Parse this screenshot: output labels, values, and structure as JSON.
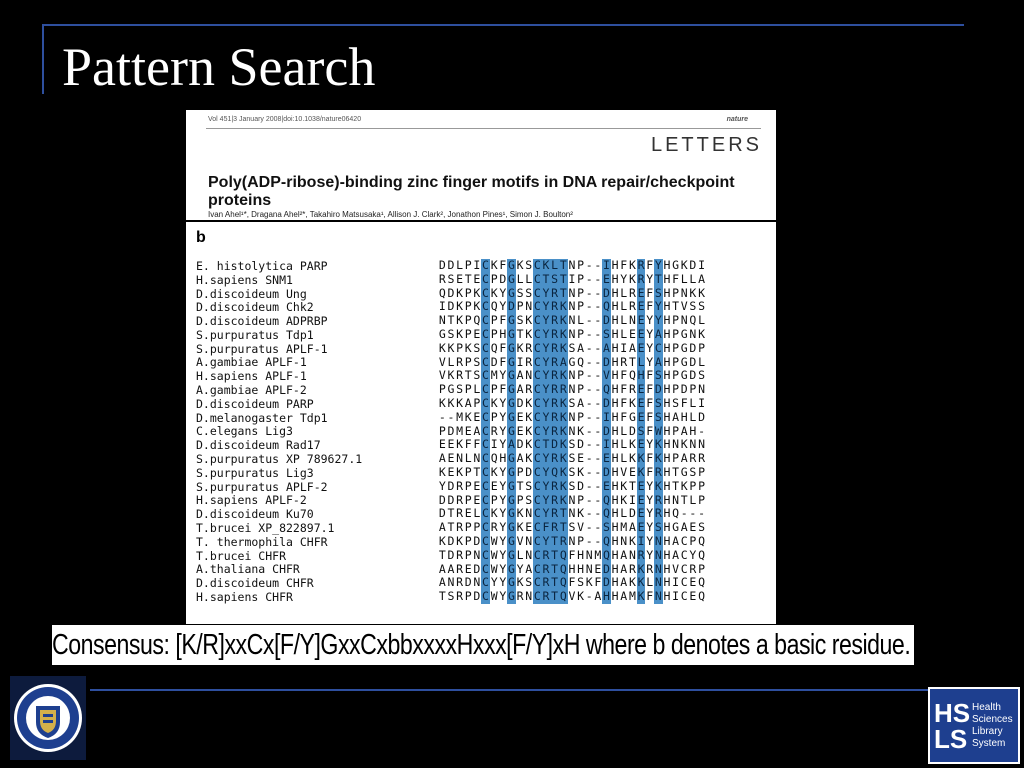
{
  "slide": {
    "title": "Pattern Search",
    "consensus": "Consensus: [K/R]xxCx[F/Y]GxxCxbbxxxxHxxx[F/Y]xH where b denotes a basic residue."
  },
  "paper": {
    "header_line": "Vol 451|3 January 2008|doi:10.1038/nature06420",
    "journal": "nature",
    "section": "LETTERS",
    "title": "Poly(ADP-ribose)-binding zinc finger motifs in DNA repair/checkpoint proteins",
    "authors": "Ivan Ahel¹*, Dragana Ahel²*, Takahiro Matsusaka¹, Allison J. Clark², Jonathon Pines¹, Simon J. Boulton²"
  },
  "alignment": {
    "panel_label": "b",
    "rows": [
      {
        "species": "E. histolytica PARP",
        "seq": "DDLPICKFGKSCKLTNP--IHFKRFYHGKDI"
      },
      {
        "species": "H.sapiens SNM1",
        "seq": "RSETECPDGLLCTSTIP--EHYKRYTHFLLA"
      },
      {
        "species": "D.discoideum Ung",
        "seq": "QDKPKCKYGSSCYRTNP--DHLREFSHPNKK"
      },
      {
        "species": "D.discoideum Chk2",
        "seq": "IDKPKCQYDPNCYRKNP--QHLREFYHTVSS"
      },
      {
        "species": "D.discoideum ADPRBP",
        "seq": "NTKPQCPFGSKCYRKNL--DHLNEYYHPNQL"
      },
      {
        "species": "S.purpuratus Tdp1",
        "seq": "GSKPECPHGTKCYRKNP--SHLEEYAHPGNK"
      },
      {
        "species": "S.purpuratus APLF-1",
        "seq": "KKPKSCQFGKRCYRKSA--AHIAEYCHPGDP"
      },
      {
        "species": "A.gambiae APLF-1",
        "seq": "VLRPSCDFGIRCYRAGQ--DHRTLYAHPGDL"
      },
      {
        "species": "H.sapiens APLF-1",
        "seq": "VKRTSCMYGANCYRKNP--VHFQHFSHPGDS"
      },
      {
        "species": "A.gambiae APLF-2",
        "seq": "PGSPLCPFGARCYRRNP--QHFREFDHPDPN"
      },
      {
        "species": "D.discoideum PARP",
        "seq": "KKKAPCKYGDKCYRKSA--DHFKEFSHSFLI"
      },
      {
        "species": "D.melanogaster Tdp1",
        "seq": "--MKECPYGEKCYRKNP--IHFGEFSHAHLD"
      },
      {
        "species": "C.elegans Lig3",
        "seq": "PDMEACRYGEKCYRKNK--DHLDSFWHPAH-"
      },
      {
        "species": "D.discoideum Rad17",
        "seq": "EEKFFCIYADKCTDKSD--IHLKEYKHNKNN"
      },
      {
        "species": "S.purpuratus XP 789627.1",
        "seq": "AENLNCQHGAKCYRKSE--EHLKKFKHPARR"
      },
      {
        "species": "S.purpuratus Lig3",
        "seq": "KEKPTCKYGPDCYQKSK--DHVEKFRHTGSP"
      },
      {
        "species": "S.purpuratus APLF-2",
        "seq": "YDRPECEYGTSCYRKSD--EHKTEYKHTKPP"
      },
      {
        "species": "H.sapiens APLF-2",
        "seq": "DDRPECPYGPSCYRKNP--QHKIEYRHNTLP"
      },
      {
        "species": "D.discoideum Ku70",
        "seq": "DTRELCKYGKNCYRTNK--QHLDEYRHQ---"
      },
      {
        "species": "T.brucei XP_822897.1",
        "seq": "ATRPPCRYGKECFRTSV--SHMAEYSHGAES"
      },
      {
        "species": "T. thermophila CHFR",
        "seq": "KDKPDCWYGVNCYTRNP--QHNKIYNHACPQ"
      },
      {
        "species": "T.brucei CHFR",
        "seq": "TDRPNCWYGLNCRTQFHNMQHANRYNHACYQ"
      },
      {
        "species": "A.thaliana CHFR",
        "seq": "AAREDCWYGYACRTQHHNEDHARKRNHVCRP"
      },
      {
        "species": "D.discoideum CHFR",
        "seq": "ANRDNCYYGKSCRTQFSKFDHAKKLNHICEQ"
      },
      {
        "species": "H.sapiens CHFR",
        "seq": "TSRPDCWYGRNCRTQVK-AHHAMKFNHICEQ"
      }
    ]
  },
  "logos": {
    "left": {
      "ring_top": "UNIVERSITY OF",
      "ring_bottom": "PITTSBURGH"
    },
    "right": {
      "letters_1": "HS",
      "letters_2": "LS",
      "lines": [
        "Health",
        "Sciences",
        "Library",
        "System"
      ]
    }
  },
  "colors": {
    "background": "#000000",
    "accent": "#2e4f9e",
    "highlight": "#4a90c8"
  }
}
